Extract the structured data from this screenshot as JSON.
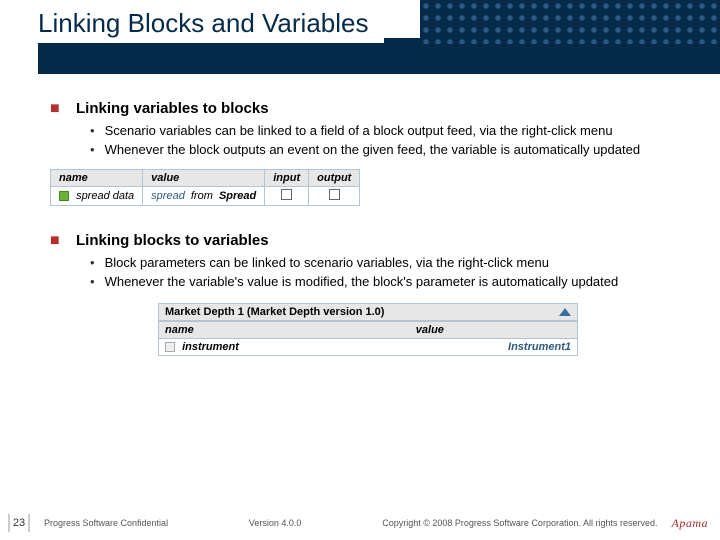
{
  "title": "Linking Blocks and Variables",
  "section1": {
    "title": "Linking variables to blocks",
    "bullets": [
      "Scenario variables can be linked to a field of a block output feed, via the right-click menu",
      "Whenever the block outputs an event on the given feed, the variable is automatically updated"
    ],
    "table": {
      "headers": {
        "name": "name",
        "value": "value",
        "input": "input",
        "output": "output"
      },
      "row": {
        "name": "spread data",
        "value_field": "spread",
        "value_from_label": "from",
        "value_from": "Spread"
      }
    }
  },
  "section2": {
    "title": "Linking blocks to variables",
    "bullets": [
      "Block parameters can be linked to scenario variables, via the right-click menu",
      "Whenever the variable's value is modified, the block's parameter is automatically updated"
    ],
    "panel": {
      "title": "Market Depth 1 (Market Depth version 1.0)",
      "headers": {
        "name": "name",
        "value": "value"
      },
      "row": {
        "name": "instrument",
        "value": "Instrument1"
      }
    }
  },
  "footer": {
    "page": "23",
    "confidential": "Progress Software Confidential",
    "version": "Version 4.0.0",
    "copyright": "Copyright © 2008 Progress Software Corporation. All rights reserved.",
    "brand": "Apama"
  }
}
